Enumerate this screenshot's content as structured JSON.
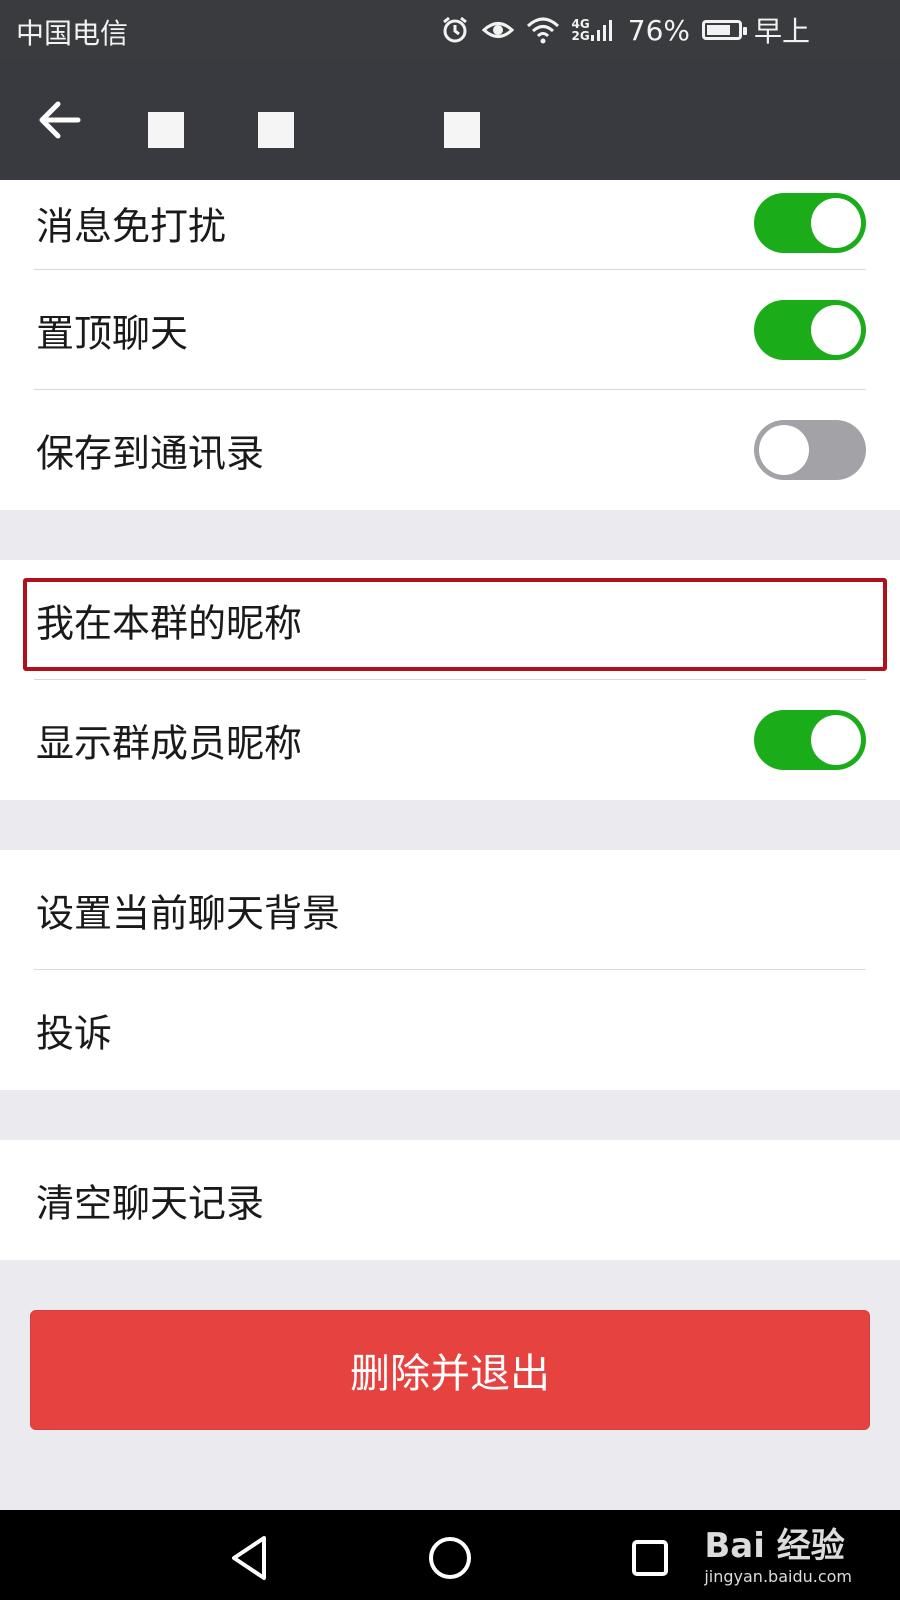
{
  "status_bar": {
    "carrier": "中国电信",
    "network_top": "4G",
    "network_bottom": "2G",
    "battery_percent": "76%",
    "battery_level": 0.76,
    "time_text": "早上"
  },
  "settings": {
    "group1": [
      {
        "label": "消息免打扰",
        "toggle": "on"
      },
      {
        "label": "置顶聊天",
        "toggle": "on"
      },
      {
        "label": "保存到通讯录",
        "toggle": "off"
      }
    ],
    "group2": [
      {
        "label": "我在本群的昵称"
      },
      {
        "label": "显示群成员昵称",
        "toggle": "on"
      }
    ],
    "group3": [
      {
        "label": "设置当前聊天背景"
      },
      {
        "label": "投诉"
      }
    ],
    "group4": [
      {
        "label": "清空聊天记录"
      }
    ]
  },
  "delete_button_label": "删除并退出",
  "watermark": {
    "line1": "Bai 经验",
    "line2": "jingyan.baidu.com"
  },
  "colors": {
    "toggle_on": "#1aad19",
    "toggle_off": "#a3a2a7",
    "danger": "#e64340",
    "highlight": "#b0101a",
    "navbar": "#393a3f"
  }
}
